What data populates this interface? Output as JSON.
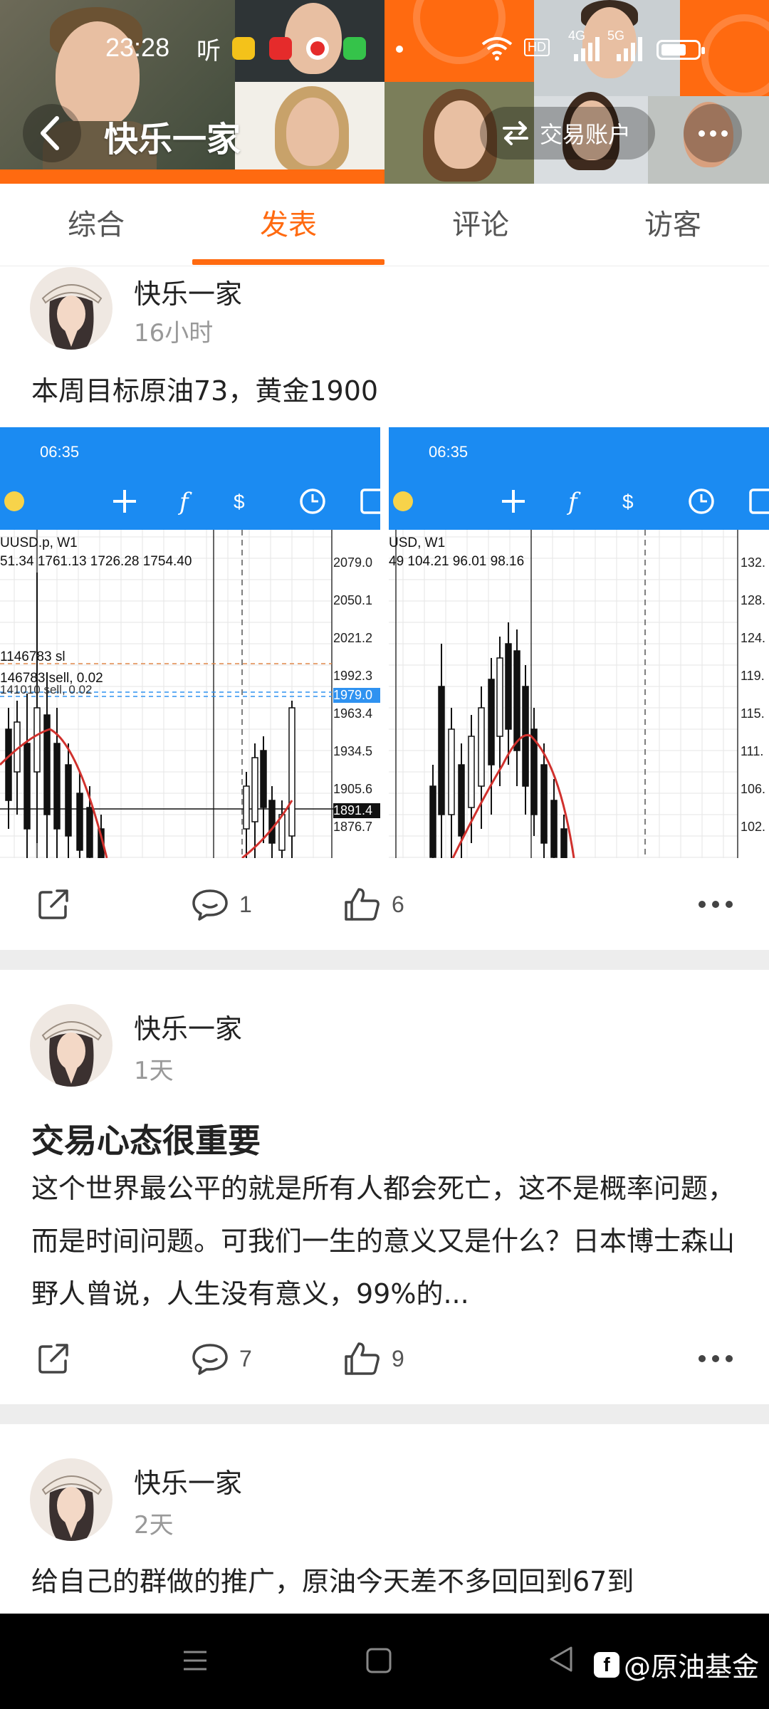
{
  "status_bar": {
    "time": "23:28",
    "listen": "听",
    "network": "4G 5G",
    "hd": "HD"
  },
  "header": {
    "title": "快乐一家",
    "account_button": "交易账户"
  },
  "tabs": [
    {
      "label": "综合",
      "active": false
    },
    {
      "label": "发表",
      "active": true
    },
    {
      "label": "评论",
      "active": false
    },
    {
      "label": "访客",
      "active": false
    }
  ],
  "posts": [
    {
      "author": "快乐一家",
      "time": "16小时",
      "text": "本周目标原油73，黄金1900",
      "comments": "1",
      "likes": "6",
      "images": [
        {
          "clock": "06:35",
          "symbol": "UUSD.p, W1",
          "ohlc": "51.34 1761.13 1726.28 1754.40",
          "order_sl": "1146783 sl",
          "order_sell": "146783 sell, 0.02",
          "order_sell_2": "141010 sell, 0.02",
          "price_axis": [
            "2079.0",
            "2050.1",
            "2021.2",
            "1992.3",
            "1963.4",
            "1934.5",
            "1905.6",
            "1876.7"
          ],
          "price_marker": "1979.0",
          "price_marker_2": "1891.4"
        },
        {
          "clock": "06:35",
          "symbol": "USD, W1",
          "ohlc": "49 104.21 96.01 98.16",
          "price_axis": [
            "132.",
            "128.",
            "124.",
            "119.",
            "115.",
            "111.",
            "106.",
            "102."
          ]
        }
      ]
    },
    {
      "author": "快乐一家",
      "time": "1天",
      "heading": "交易心态很重要",
      "body": "这个世界最公平的就是所有人都会死亡，这不是概率问题，而是时间问题。可我们一生的意义又是什么？日本博士森山野人曾说，人生没有意义，99%的...",
      "comments": "7",
      "likes": "9"
    },
    {
      "author": "快乐一家",
      "time": "2天",
      "text": "给自己的群做的推广，原油今天差不多回回到67到"
    }
  ],
  "watermark": "@原油基金",
  "colors": {
    "accent": "#ff6a10",
    "chart_bar": "#1b8bf2"
  }
}
